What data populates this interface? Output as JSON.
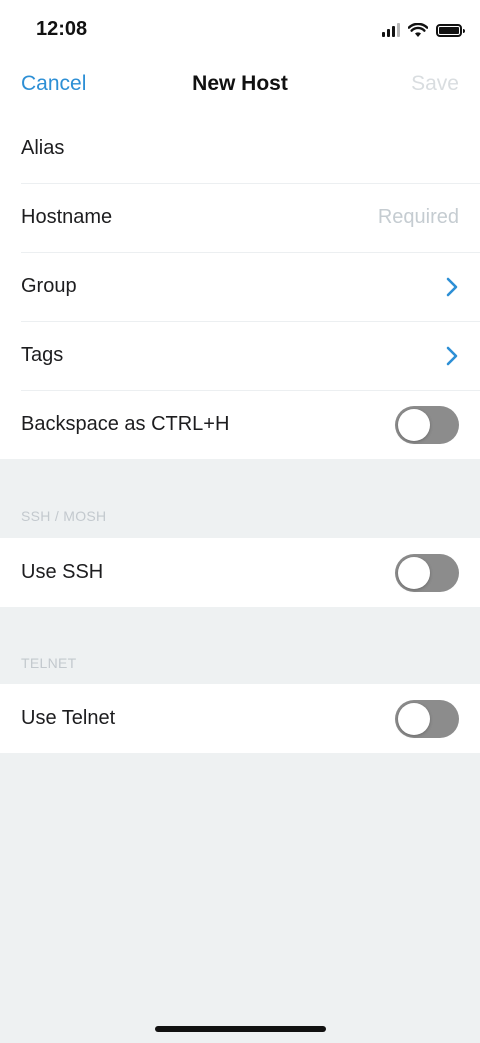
{
  "status_bar": {
    "time": "12:08"
  },
  "nav": {
    "cancel_label": "Cancel",
    "title": "New Host",
    "save_label": "Save"
  },
  "general": {
    "rows": [
      {
        "label": "Alias",
        "value": ""
      },
      {
        "label": "Hostname",
        "value": "Required"
      },
      {
        "label": "Group",
        "accessory": "chevron-right-icon"
      },
      {
        "label": "Tags",
        "accessory": "chevron-right-icon"
      },
      {
        "label": "Backspace as CTRL+H",
        "toggle_on": false
      }
    ]
  },
  "ssh": {
    "header": "SSH / MOSH",
    "label": "Use SSH",
    "toggle_on": false
  },
  "telnet": {
    "header": "TELNET",
    "label": "Use Telnet",
    "toggle_on": false
  },
  "colors": {
    "accent": "#2d8fd5",
    "disabled_text": "#d9dde0",
    "background": "#eef1f2",
    "toggle_off": "#8c8c8c"
  }
}
